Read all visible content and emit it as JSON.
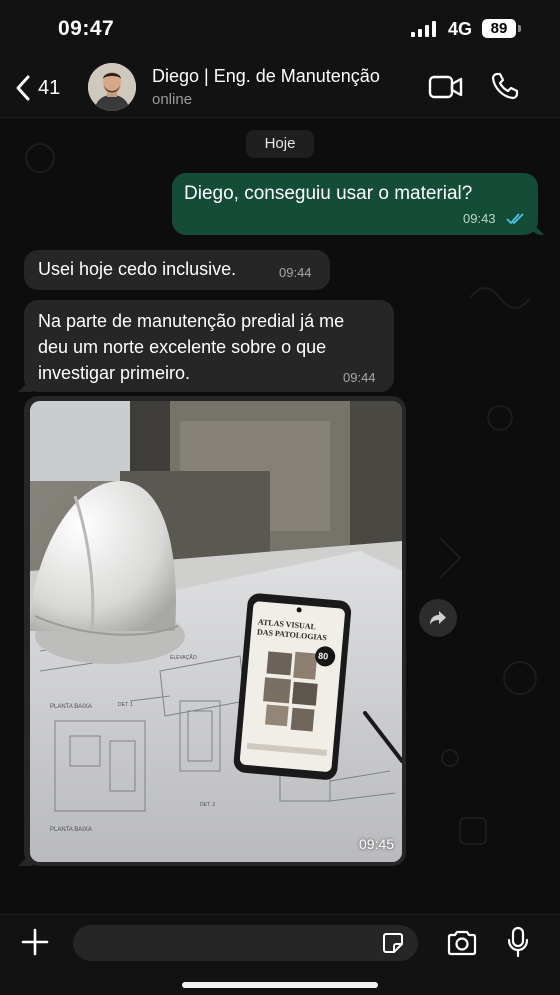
{
  "status_bar": {
    "time": "09:47",
    "network": "4G",
    "battery": "89"
  },
  "header": {
    "unread_count": "41",
    "contact_name": "Diego | Eng. de Manutenção",
    "contact_status": "online",
    "icons": [
      "chevron-left-icon",
      "video-camera-icon",
      "phone-icon"
    ]
  },
  "chat": {
    "date_label": "Hoje",
    "messages": [
      {
        "direction": "outgoing",
        "text": "Diego, conseguiu usar o material?",
        "time": "09:43",
        "status": "read"
      },
      {
        "direction": "incoming",
        "text": "Usei hoje cedo inclusive.",
        "time": "09:44"
      },
      {
        "direction": "incoming",
        "text": "Na parte de manutenção predial já me deu um norte excelente sobre o que investigar primeiro.",
        "time": "09:44"
      },
      {
        "direction": "incoming",
        "type": "image",
        "time": "09:45"
      }
    ]
  },
  "photo": {
    "book_title_1": "ATLAS VISUAL",
    "book_title_2": "DAS PATOLOGIAS",
    "badge_number": "80",
    "plan_label_1": "PLANTA BAIXA",
    "plan_label_2": "PLANTA BAIXA",
    "elevation_label": "ELEVAÇÃO",
    "detail_label_1": "DET. 1",
    "detail_label_3": "DET. 3"
  },
  "input_bar": {
    "placeholder": "",
    "icons": [
      "plus-icon",
      "sticker-icon",
      "camera-icon",
      "microphone-icon"
    ]
  },
  "colors": {
    "outgoing_bubble": "#144d37",
    "incoming_bubble": "#262626",
    "read_ticks": "#53bdeb",
    "background": "#0d0d0d"
  }
}
